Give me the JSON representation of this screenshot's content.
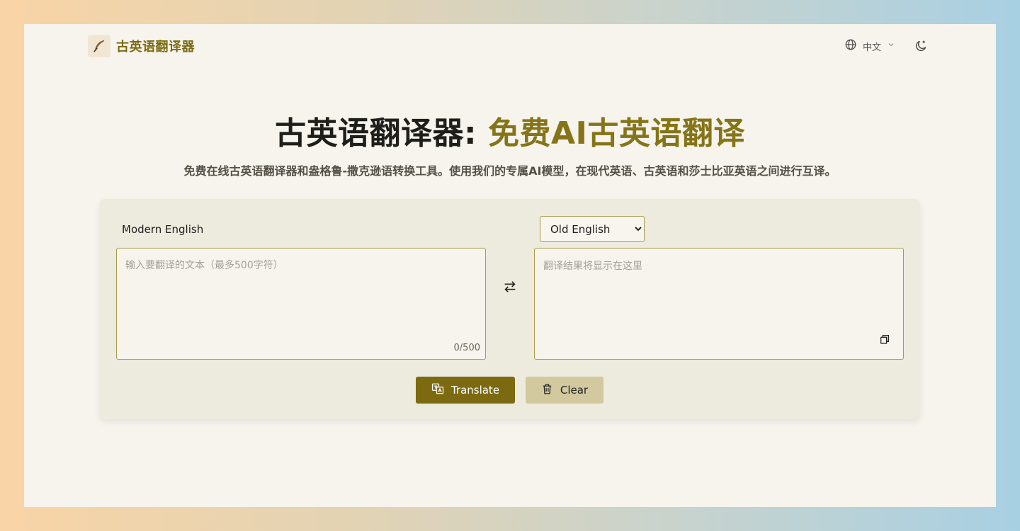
{
  "nav": {
    "brand": "古英语翻译器",
    "language": "中文"
  },
  "hero": {
    "title_main": "古英语翻译器:",
    "title_accent": "免费AI古英语翻译",
    "subtitle": "免费在线古英语翻译器和盎格鲁-撒克逊语转换工具。使用我们的专属AI模型，在现代英语、古英语和莎士比亚英语之间进行互译。"
  },
  "translator": {
    "source_label": "Modern English",
    "target_selected": "Old English",
    "source_placeholder": "输入要翻译的文本（最多500字符）",
    "target_placeholder": "翻译结果将显示在这里",
    "counter": "0/500",
    "translate_label": "Translate",
    "clear_label": "Clear"
  },
  "colors": {
    "accent": "#7c6a10",
    "background": "#f6f4ec",
    "card": "#edeade",
    "clear_button": "#d2c99f"
  }
}
